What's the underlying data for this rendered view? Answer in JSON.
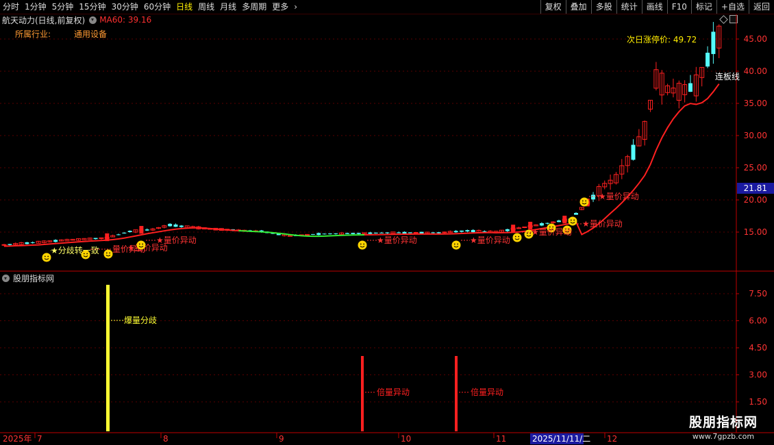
{
  "toolbar": {
    "periods": [
      "分时",
      "1分钟",
      "5分钟",
      "15分钟",
      "30分钟",
      "60分钟",
      "日线",
      "周线",
      "月线",
      "多周期",
      "更多"
    ],
    "active_period": "日线",
    "more_arrow": "›",
    "actions": [
      "复权",
      "叠加",
      "多股",
      "统计",
      "画线",
      "F10",
      "标记",
      "+自选",
      "返回"
    ]
  },
  "header": {
    "stock_title": "航天动力(日线,前复权)",
    "ma_label": "MA60: 39.16",
    "industry_label": "所属行业:",
    "industry_value": "通用设备",
    "limit_up_text": "次日涨停价: 49.72",
    "right_label": "连板线"
  },
  "price_axis": {
    "ticks": [
      "45.00",
      "40.00",
      "35.00",
      "30.00",
      "25.00",
      "20.00",
      "15.00"
    ],
    "current_price": "21.81"
  },
  "indicator": {
    "name": "股朋指标网",
    "ticks": [
      "7.50",
      "6.00",
      "4.50",
      "3.00",
      "1.50"
    ],
    "labels": [
      "爆量分歧",
      "倍量异动",
      "倍量异动"
    ]
  },
  "signals": {
    "labels": [
      "★分歧转一致",
      "量价异动",
      "★量价异动",
      "★量价异动",
      "★量价异动",
      "★量价异动",
      "★量价异动",
      "★量价异动",
      "★量价异动"
    ]
  },
  "time_axis": {
    "labels": [
      "2025年",
      "7",
      "8",
      "9",
      "10",
      "11",
      "2025/11/11/二",
      "12"
    ]
  },
  "watermark": {
    "title": "股朋指标网",
    "url": "www.7gpzb.com"
  },
  "colors": {
    "up": "#ff2020",
    "down": "#54fcfc",
    "ma": "#ff2020",
    "ma_alt": "#33ee33",
    "axis": "#c00000",
    "highlight": "#1a1aa0",
    "yellow_bar": "#ffff33",
    "smiley": "#ffd400"
  }
}
